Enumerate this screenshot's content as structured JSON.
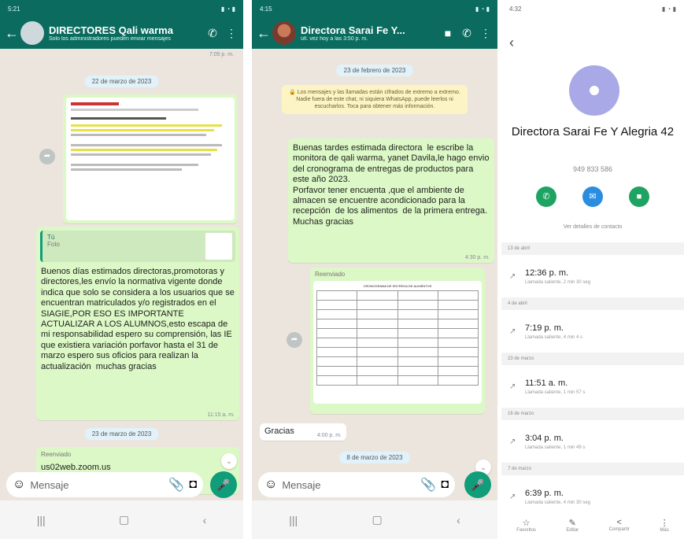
{
  "screen1": {
    "status_time": "5:21",
    "title": "DIRECTORES Qali warma",
    "subtitle": "Solo los administradores pueden enviar mensajes",
    "top_time": "7:05 p. m.",
    "date_chip": "22 de marzo de 2023",
    "doc_time": "11:15 a. m.",
    "quote_author": "Tú",
    "quote_type": "Foto",
    "message": "Buenos días estimados directoras,promotoras y directores,les envío la normativa vigente donde indica que solo se considera a los usuarios que se encuentran matriculados y/o registrados en el SIAGIE,POR ESO ES IMPORTANTE ACTUALIZAR A LOS ALUMNOS,esto escapa de mi responsabilidad espero su comprensión, las IE que existiera variación porfavor hasta el 31 de marzo espero sus oficios para realizan la actualización  muchas gracias",
    "message_time": "11:15 a. m.",
    "date_chip2": "23 de marzo de 2023",
    "forwarded_label": "Reenviado",
    "link_snippet": "us02web.zoom.us",
    "input_placeholder": "Mensaje"
  },
  "screen2": {
    "status_time": "4:15",
    "title": "Directora Sarai Fe Y...",
    "subtitle": "últ. vez hoy a las 3:50 p. m.",
    "date_chip": "23 de febrero de 2023",
    "encryption": "Los mensajes y las llamadas están cifrados de extremo a extremo. Nadie fuera de este chat, ni siquiera WhatsApp, puede leerlos ni escucharlos. Toca para obtener más información.",
    "message": "Buenas tardes estimada directora  le escribe la monitora de qali warma, yanet Davila,le hago envio del cronograma de entregas de productos para este año 2023.\nPorfavor tener encuenta ,que el ambiente de almacen se encuentre acondicionado para la recepción  de los alimentos  de la primera entrega.\nMuchas gracias",
    "message_time": "4:30 p. m.",
    "forwarded_label": "Reenviado",
    "table_title": "CRONOGRAMA DE ENTREGA DE ALIMENTOS",
    "incoming": "Gracias",
    "incoming_time": "4:00 p. m.",
    "date_chip2": "8 de marzo de 2023",
    "input_placeholder": "Mensaje"
  },
  "screen3": {
    "status_time": "4:32",
    "name": "Directora Sarai Fe Y Alegria 42",
    "phone": "949 833 586",
    "details_link": "Ver detalles de contacto",
    "calls": [
      {
        "date": "13 de abril",
        "time": "12:36 p. m.",
        "detail": "Llamada saliente, 2 min 30 seg"
      },
      {
        "date": "4 de abril",
        "time": "7:19 p. m.",
        "detail": "Llamada saliente, 4 min 4 s"
      },
      {
        "date": "23 de marzo",
        "time": "11:51 a. m.",
        "detail": "Llamada saliente, 1 min 57 s"
      },
      {
        "date": "16 de marzo",
        "time": "3:04 p. m.",
        "detail": "Llamada saliente, 1 min 49 s"
      },
      {
        "date": "7 de marzo",
        "time": "6:39 p. m.",
        "detail": "Llamada saliente, 4 min 30 seg"
      }
    ],
    "tabs": [
      "Favoritos",
      "Editar",
      "Compartir",
      "Más"
    ]
  },
  "colors": {
    "header": "#0b6b5f",
    "outgoing": "#dcf8c6",
    "chat_bg": "#ece5dd",
    "accent": "#0f9d7a"
  }
}
